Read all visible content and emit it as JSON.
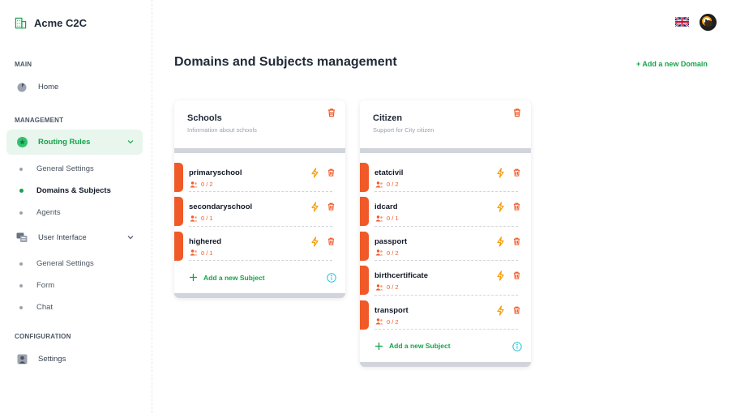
{
  "app": {
    "name": "Acme C2C"
  },
  "sidebar": {
    "sections": {
      "main": "MAIN",
      "management": "MANAGEMENT",
      "configuration": "CONFIGURATION"
    },
    "home": "Home",
    "routing_rules": {
      "label": "Routing Rules",
      "children": [
        "General Settings",
        "Domains & Subjects",
        "Agents"
      ]
    },
    "user_interface": {
      "label": "User Interface",
      "children": [
        "General Settings",
        "Form",
        "Chat"
      ]
    },
    "settings": "Settings"
  },
  "header": {
    "language_icon": "uk-flag-icon",
    "avatar_icon": "user-avatar"
  },
  "page": {
    "title": "Domains and Subjects management",
    "add_domain": "+ Add a new Domain"
  },
  "domains": [
    {
      "title": "Schools",
      "subtitle": "Information about schools",
      "subjects": [
        {
          "name": "primaryschool",
          "count": "0 / 2"
        },
        {
          "name": "secondaryschool",
          "count": "0 / 1"
        },
        {
          "name": "highered",
          "count": "0 / 1"
        }
      ],
      "add_subject": "Add a new Subject"
    },
    {
      "title": "Citizen",
      "subtitle": "Support for City citizen",
      "subjects": [
        {
          "name": "etatcivil",
          "count": "0 / 2"
        },
        {
          "name": "idcard",
          "count": "0 / 1"
        },
        {
          "name": "passport",
          "count": "0 / 2"
        },
        {
          "name": "birthcertificate",
          "count": "0 / 2"
        },
        {
          "name": "transport",
          "count": "0 / 2"
        }
      ],
      "add_subject": "Add a new Subject"
    }
  ],
  "colors": {
    "accent": "#16a34a",
    "subject_accent": "#f05a28",
    "bolt": "#f59e0b",
    "info": "#22c3d6"
  }
}
